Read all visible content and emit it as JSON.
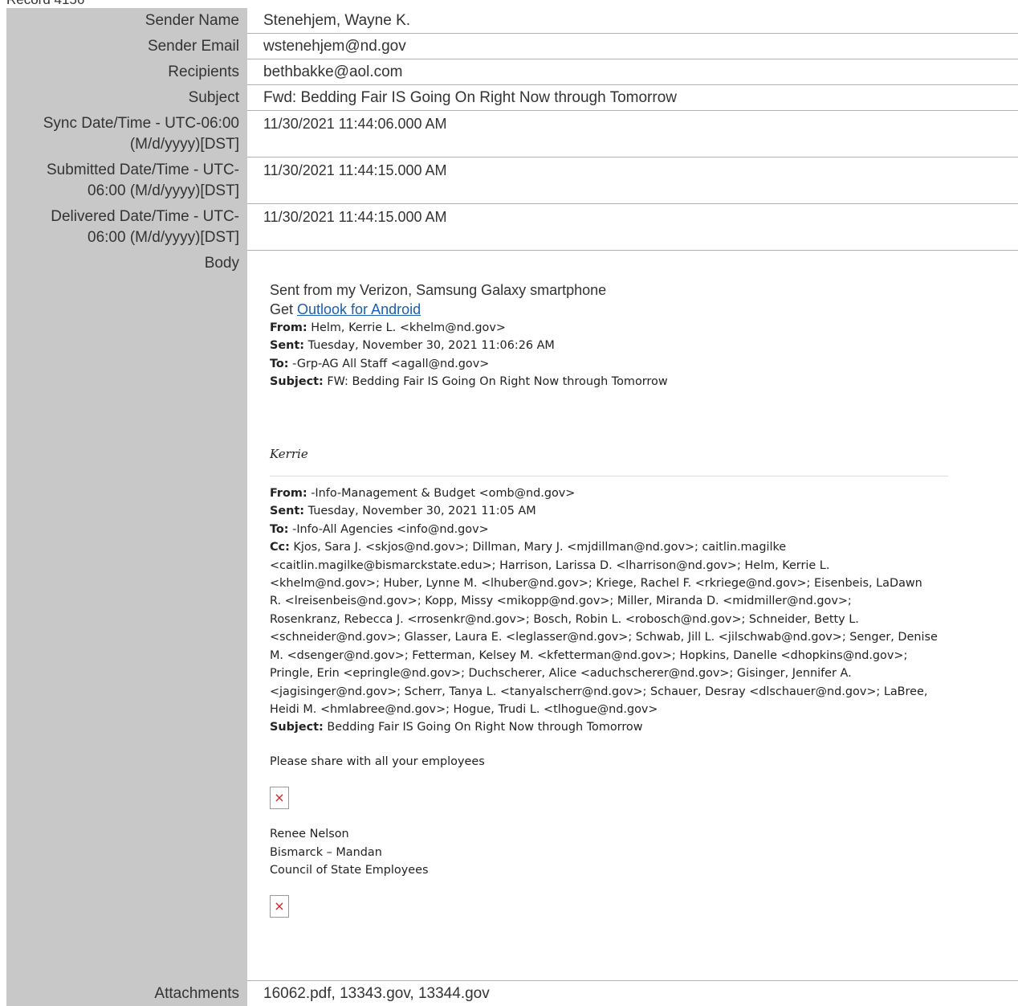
{
  "record_title": "Record 4156",
  "fields": {
    "sender_name": {
      "label": "Sender Name",
      "value": "Stenehjem, Wayne K."
    },
    "sender_email": {
      "label": "Sender Email",
      "value": "wstenehjem@nd.gov"
    },
    "recipients": {
      "label": "Recipients",
      "value": "bethbakke@aol.com"
    },
    "subject": {
      "label": "Subject",
      "value": "Fwd: Bedding Fair IS Going On Right Now through Tomorrow"
    },
    "sync": {
      "label_line1": "Sync Date/Time - UTC-06:00",
      "label_line2": "(M/d/yyyy)[DST]",
      "value": "11/30/2021 11:44:06.000 AM"
    },
    "submitted": {
      "label_line1": "Submitted Date/Time - UTC-",
      "label_line2": "06:00 (M/d/yyyy)[DST]",
      "value": "11/30/2021 11:44:15.000 AM"
    },
    "delivered": {
      "label_line1": "Delivered Date/Time - UTC-",
      "label_line2": "06:00 (M/d/yyyy)[DST]",
      "value": "11/30/2021 11:44:15.000 AM"
    },
    "body_label": "Body",
    "attachments": {
      "label": "Attachments",
      "value": "16062.pdf, 13343.gov, 13344.gov"
    }
  },
  "body": {
    "sent_from": "Sent from my Verizon, Samsung Galaxy smartphone",
    "get_prefix": "Get ",
    "get_link": "Outlook for Android",
    "fwd1": {
      "from_label": "From:",
      "from": " Helm, Kerrie L. <khelm@nd.gov>",
      "sent_label": "Sent:",
      "sent": " Tuesday, November 30, 2021 11:06:26 AM",
      "to_label": "To:",
      "to": " -Grp-AG All Staff <agall@nd.gov>",
      "subject_label": "Subject:",
      "subject": " FW: Bedding Fair IS Going On Right Now through Tomorrow"
    },
    "signature": "Kerrie",
    "fwd2": {
      "from_label": "From:",
      "from": " -Info-Management & Budget <omb@nd.gov>",
      "sent_label": "Sent:",
      "sent": " Tuesday, November 30, 2021 11:05 AM",
      "to_label": "To:",
      "to": " -Info-All Agencies <info@nd.gov>",
      "cc_label": "Cc:",
      "cc_lines": [
        " Kjos, Sara J. <skjos@nd.gov>; Dillman, Mary J. <mjdillman@nd.gov>; caitlin.magilke",
        "<caitlin.magilke@bismarckstate.edu>; Harrison, Larissa D. <lharrison@nd.gov>; Helm, Kerrie L.",
        "<khelm@nd.gov>; Huber, Lynne M. <lhuber@nd.gov>; Kriege, Rachel F. <rkriege@nd.gov>; Eisenbeis, LaDawn",
        "R. <lreisenbeis@nd.gov>; Kopp, Missy <mikopp@nd.gov>; Miller, Miranda D. <midmiller@nd.gov>;",
        "Rosenkranz, Rebecca J. <rrosenkr@nd.gov>; Bosch, Robin L. <robosch@nd.gov>; Schneider, Betty L.",
        "<schneider@nd.gov>; Glasser, Laura E. <leglasser@nd.gov>; Schwab, Jill L. <jilschwab@nd.gov>; Senger, Denise",
        "M. <dsenger@nd.gov>; Fetterman, Kelsey M. <kfetterman@nd.gov>; Hopkins, Danelle <dhopkins@nd.gov>;",
        "Pringle, Erin <epringle@nd.gov>; Duchscherer, Alice <aduchscherer@nd.gov>; Gisinger, Jennifer A.",
        "<jagisinger@nd.gov>; Scherr, Tanya L. <tanyalscherr@nd.gov>; Schauer, Desray <dlschauer@nd.gov>; LaBree,",
        "Heidi M. <hmlabree@nd.gov>; Hogue, Trudi L. <tlhogue@nd.gov>"
      ],
      "subject_label": "Subject:",
      "subject": " Bedding Fair IS Going On Right Now through Tomorrow"
    },
    "share_text": "Please share with all your employees",
    "broken_image_glyph": "×",
    "sender_name": "Renee Nelson",
    "sender_city": "Bismarck – Mandan",
    "sender_org": "Council of State Employees",
    "link_color": "#1a5fb4"
  },
  "colors": {
    "label_bg": "#c8c8c8",
    "broken_x": "#d02020"
  }
}
